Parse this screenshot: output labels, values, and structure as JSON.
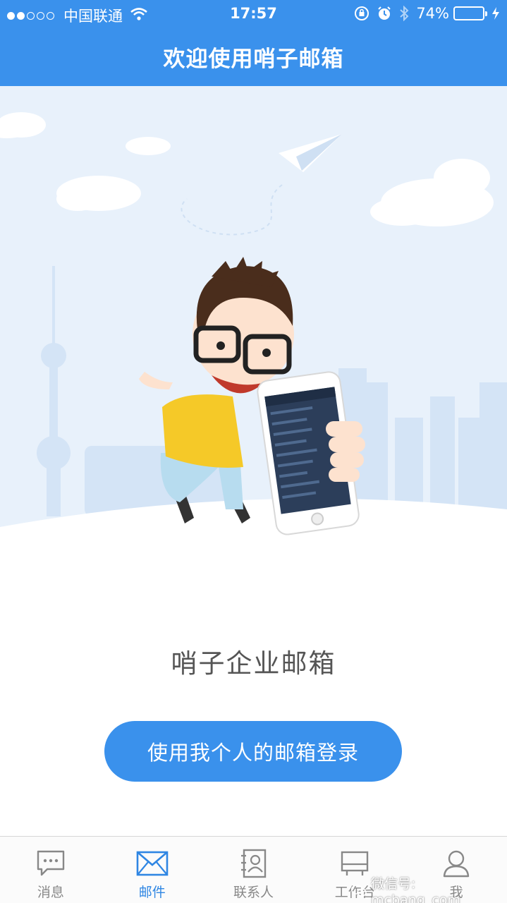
{
  "status_bar": {
    "carrier": "中国联通",
    "time": "17:57",
    "battery": "74%",
    "battery_level": 0.74,
    "icons": [
      "signal-dots-icon",
      "wifi-icon",
      "rotation-lock-icon",
      "alarm-icon",
      "bluetooth-icon",
      "battery-icon",
      "charging-icon"
    ]
  },
  "header": {
    "title": "欢迎使用哨子邮箱"
  },
  "main": {
    "product_name": "哨子企业邮箱",
    "login_button": "使用我个人的邮箱登录"
  },
  "tabbar": {
    "tabs": [
      {
        "label": "消息",
        "icon": "chat-bubble-icon",
        "active": false
      },
      {
        "label": "邮件",
        "icon": "envelope-icon",
        "active": true
      },
      {
        "label": "联系人",
        "icon": "contact-card-icon",
        "active": false
      },
      {
        "label": "工作台",
        "icon": "desk-icon",
        "active": false
      },
      {
        "label": "我",
        "icon": "person-icon",
        "active": false
      }
    ]
  },
  "watermark": "微信号: mcbang_com",
  "colors": {
    "primary": "#3a91ec",
    "tab_active": "#2f86e3",
    "tab_inactive": "#888888",
    "sky": "#e6f0fb"
  }
}
